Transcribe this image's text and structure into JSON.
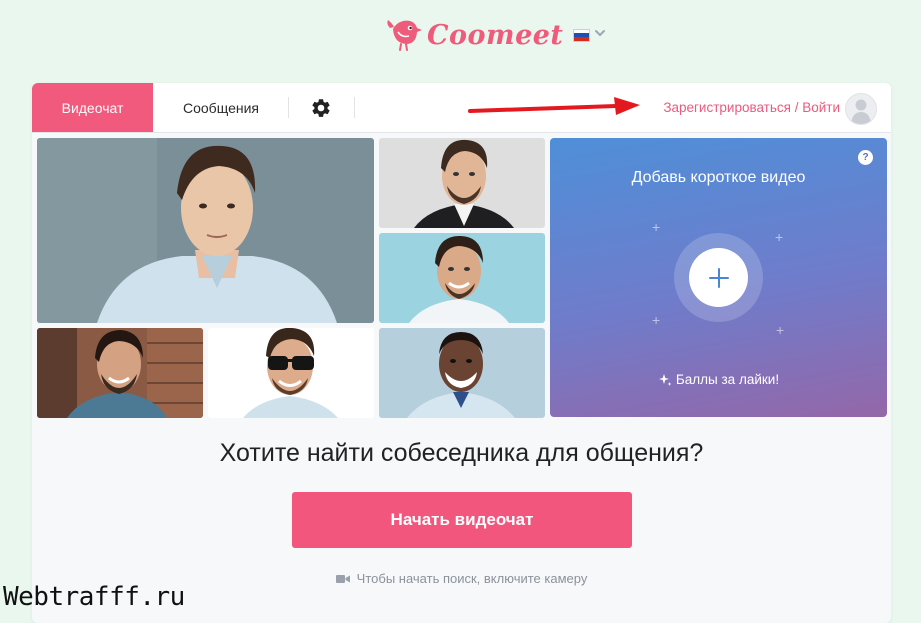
{
  "header": {
    "brand": "Coomeet",
    "language_icon": "russian-flag-icon",
    "language_dropdown_icon": "chevron-down-icon"
  },
  "nav": {
    "tabs": [
      {
        "label": "Видеочат",
        "active": true
      },
      {
        "label": "Сообщения",
        "active": false
      }
    ],
    "settings_icon": "gear-icon",
    "auth_link": "Зарегистрироваться / Войти",
    "avatar_icon": "user-avatar-icon"
  },
  "promo": {
    "title": "Добавь короткое видео",
    "help": "?",
    "add_icon": "plus-icon",
    "bonus_icon": "sparkle-icon",
    "bonus_text": "Баллы за лайки!"
  },
  "main": {
    "headline": "Хотите найти собеседника для общения?",
    "start_button": "Начать видеочат",
    "camera_icon": "camera-icon",
    "camera_hint": "Чтобы начать поиск, включите камеру"
  },
  "watermark": "Webtrafff.ru",
  "colors": {
    "accent": "#f25a7d",
    "page_background": "#e9f7ef",
    "arrow": "#e3191f",
    "promo_gradient": [
      "#4f8fd8",
      "#9467a8"
    ]
  }
}
